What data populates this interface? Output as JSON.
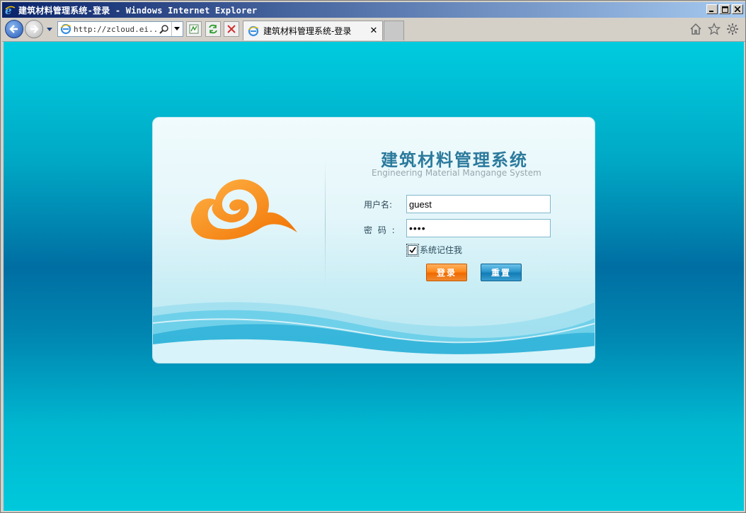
{
  "window": {
    "title": "建筑材料管理系统-登录 - Windows Internet Explorer",
    "controls": {
      "minimize": "_",
      "maximize": "□",
      "close": "✕"
    }
  },
  "browser": {
    "address": "http://zcloud.ei...",
    "tab_label": "建筑材料管理系统-登录",
    "tab_close": "✕",
    "icons": [
      "back-icon",
      "forward-icon",
      "recent-pages-icon",
      "ie-page-icon",
      "search-icon",
      "compatibility-view-icon",
      "refresh-icon",
      "stop-icon",
      "home-icon",
      "favorites-icon",
      "tools-gear-icon"
    ]
  },
  "login": {
    "title": "建筑材料管理系统",
    "subtitle": "Engineering Material Mangange System",
    "username_label": "用户名:",
    "username_value": "guest",
    "password_label": "密 码 :",
    "password_value": "1234",
    "remember_label": "系统记住我",
    "remember_checked": true,
    "login_button": "登录",
    "reset_button": "重置"
  },
  "colors": {
    "background_top": "#00ccdf",
    "background_mid": "#006ea2",
    "title_color": "#2b7a9c",
    "login_button": "#ff8a1c",
    "reset_button": "#127cb6",
    "logo": "#f7941d"
  }
}
